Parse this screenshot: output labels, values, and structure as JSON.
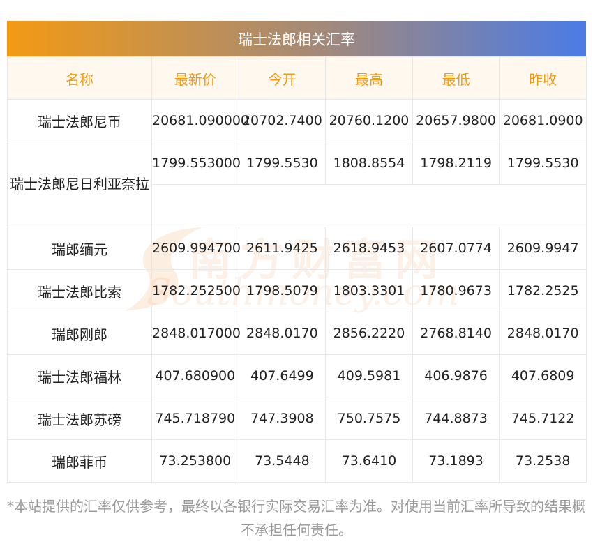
{
  "title": "瑞士法郎相关汇率",
  "columns": [
    "名称",
    "最新价",
    "今开",
    "最高",
    "最低",
    "昨收"
  ],
  "rows": [
    {
      "name": "瑞士法郎尼币",
      "latest": "20681.090000",
      "open": "20702.7400",
      "high": "20760.1200",
      "low": "20657.9800",
      "prev_close": "20681.0900"
    },
    {
      "name": "瑞士法郎尼日利亚奈拉",
      "latest": "1799.553000",
      "open": "1799.5530",
      "high": "1808.8554",
      "low": "1798.2119",
      "prev_close": "1799.5530"
    },
    {
      "name": "瑞郎缅元",
      "latest": "2609.994700",
      "open": "2611.9425",
      "high": "2618.9453",
      "low": "2607.0774",
      "prev_close": "2609.9947"
    },
    {
      "name": "瑞士法郎比索",
      "latest": "1782.252500",
      "open": "1798.5079",
      "high": "1803.3301",
      "low": "1780.9673",
      "prev_close": "1782.2525"
    },
    {
      "name": "瑞郎刚郎",
      "latest": "2848.017000",
      "open": "2848.0170",
      "high": "2856.2220",
      "low": "2768.8140",
      "prev_close": "2848.0170"
    },
    {
      "name": "瑞士法郎福林",
      "latest": "407.680900",
      "open": "407.6499",
      "high": "409.5981",
      "low": "406.9876",
      "prev_close": "407.6809"
    },
    {
      "name": "瑞士法郎苏磅",
      "latest": "745.718790",
      "open": "747.3908",
      "high": "750.7575",
      "low": "744.8873",
      "prev_close": "745.7122"
    },
    {
      "name": "瑞郎菲币",
      "latest": "73.253800",
      "open": "73.5448",
      "high": "73.6410",
      "low": "73.1893",
      "prev_close": "73.2538"
    }
  ],
  "watermark": {
    "cn": "南方财富网",
    "en": "Southmoney.com"
  },
  "disclaimer": "*本站提供的汇率仅供参考，最终以各银行实际交易汇率为准。对使用当前汇率所导致的结果概不承担任何责任。",
  "colors": {
    "header_text": "#f39a14",
    "header_bg": "#fff8ee",
    "title_gradient_start": "#f39a14",
    "title_gradient_end": "#4b7be6",
    "disclaimer": "#9a9a9a"
  }
}
